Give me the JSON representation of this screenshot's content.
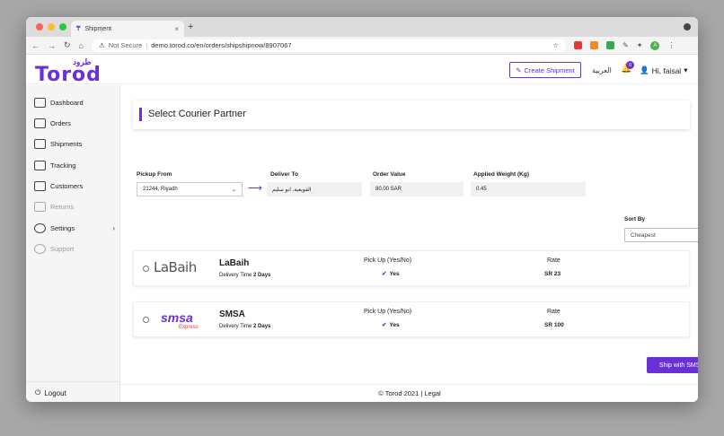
{
  "browser": {
    "tab_title": "Shipment",
    "tab_close": "×",
    "new_tab": "+",
    "security": "Not Secure",
    "url": "demo.torod.co/en/orders/shipshipnow/8907067",
    "profile_initial": "A"
  },
  "header": {
    "logo_en": "Torod",
    "logo_ar": "طرود",
    "create_shipment": "Create Shipment",
    "language": "العربية",
    "notif_count": "0",
    "greeting": "Hi, faisal"
  },
  "sidebar": {
    "items": [
      {
        "label": "Dashboard"
      },
      {
        "label": "Orders"
      },
      {
        "label": "Shipments"
      },
      {
        "label": "Tracking"
      },
      {
        "label": "Customers"
      },
      {
        "label": "Returns"
      },
      {
        "label": "Settings"
      },
      {
        "label": "Support"
      }
    ],
    "logout": "Logout"
  },
  "main": {
    "title": "Select Courier Partner",
    "pickup_label": "Pickup From",
    "pickup_value": "21244, Riyadh",
    "deliver_label": "Deliver To",
    "deliver_value": "القويعية, ابو سليم",
    "order_value_label": "Order Value",
    "order_value": "80.00 SAR",
    "weight_label": "Applied Weight (Kg)",
    "weight_value": "0.45",
    "sort_label": "Sort By",
    "sort_value": "Cheapest",
    "couriers": [
      {
        "name": "LaBaih",
        "logo_text": "LaBaih",
        "delivery_prefix": "Delivery Time",
        "delivery_time": "2 Days",
        "pickup_header": "Pick Up (Yes/No)",
        "pickup": "Yes",
        "rate_header": "Rate",
        "rate": "SR 23"
      },
      {
        "name": "SMSA",
        "logo_text": "smsa",
        "logo_sub": "Express",
        "delivery_prefix": "Delivery Time",
        "delivery_time": "2 Days",
        "pickup_header": "Pick Up (Yes/No)",
        "pickup": "Yes",
        "rate_header": "Rate",
        "rate": "SR 100"
      }
    ],
    "ship_button": "Ship with SMSA",
    "footer": "© Torod 2021 | Legal"
  },
  "colors": {
    "brand": "#6b2fd8"
  }
}
